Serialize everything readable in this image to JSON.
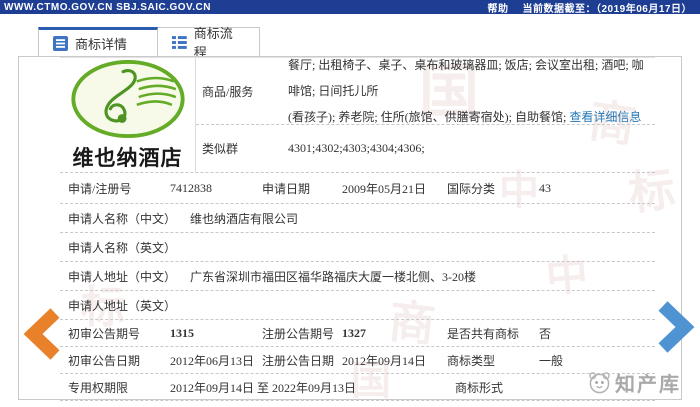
{
  "topbar": {
    "urls": "WWW.CTMO.GOV.CN SBJ.SAIC.GOV.CN",
    "help_label": "帮助",
    "data_note": "当前数据截至：（2019年06月17日）"
  },
  "tabs": {
    "detail": "商标详情",
    "process": "商标流程"
  },
  "trademark_image": {
    "name": "维也纳酒店"
  },
  "goods": {
    "label": "商品/服务",
    "line1": "餐厅; 出租椅子、桌子、桌布和玻璃器皿; 饭店; 会议室出租; 酒吧; 咖啡馆; 日间托儿所",
    "line2": "(看孩子); 养老院; 住所(旅馆、供膳寄宿处); 自助餐馆; ",
    "detail_link": "查看详细信息"
  },
  "similar_group": {
    "label": "类似群",
    "value": "4301;4302;4303;4304;4306;"
  },
  "rows": {
    "reg": {
      "l1": "申请/注册号",
      "v1": "7412838",
      "l2": "申请日期",
      "v2": "2009年05月21日",
      "l3": "国际分类",
      "v3": "43"
    },
    "name_cn": {
      "l": "申请人名称（中文）",
      "v": "维也纳酒店有限公司"
    },
    "name_en": {
      "l": "申请人名称（英文）",
      "v": ""
    },
    "addr_cn": {
      "l": "申请人地址（中文）",
      "v": "广东省深圳市福田区福华路福庆大厦一楼北侧、3-20楼"
    },
    "addr_en": {
      "l": "申请人地址（英文）",
      "v": ""
    },
    "gazette_no": {
      "l1": "初审公告期号",
      "v1": "1315",
      "l2": "注册公告期号",
      "v2": "1327",
      "l3": "是否共有商标",
      "v3": "否"
    },
    "gazette_date": {
      "l1": "初审公告日期",
      "v1": "2012年06月13日",
      "l2": "注册公告日期",
      "v2": "2012年09月14日",
      "l3": "商标类型",
      "v3": "一般"
    },
    "validity": {
      "l1": "专用权期限",
      "v1": "2012年09月14日 至 2022年09月13日",
      "l2": "商标形式",
      "v2": ""
    }
  },
  "brand_watermark": "知产库",
  "watermarks": [
    "国",
    "商",
    "标",
    "中",
    "商",
    "标",
    "中",
    "国"
  ],
  "colors": {
    "topbar_bg": "#1d3e93",
    "link": "#2878b7",
    "arrow_left": "#e8812a",
    "arrow_right": "#4f93d2",
    "logo_green": "#64ac28"
  }
}
